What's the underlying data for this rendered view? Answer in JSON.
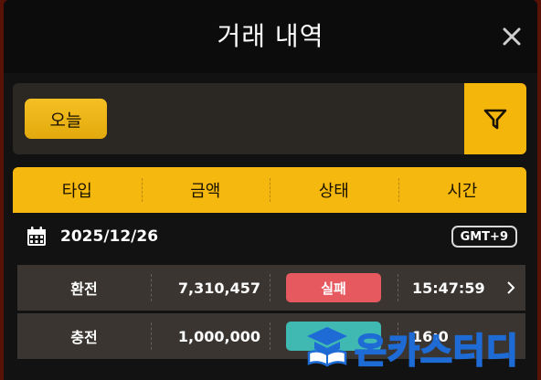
{
  "window": {
    "title": "거래 내역",
    "close_icon": "close-icon"
  },
  "filter": {
    "today_label": "오늘",
    "filter_icon": "funnel-icon"
  },
  "columns": [
    "타입",
    "금액",
    "상태",
    "시간"
  ],
  "date_group": {
    "icon": "calendar-icon",
    "date": "2025/12/26",
    "timezone": "GMT+9"
  },
  "rows": [
    {
      "type": "환전",
      "amount": "7,310,457",
      "status": "실패",
      "status_color": "#e65a5f",
      "time": "15:47:59",
      "arrow_icon": "chevron-right-icon"
    },
    {
      "type": "충전",
      "amount": "1,000,000",
      "status": "",
      "status_color": "#3fb9b2",
      "time": "16:0",
      "arrow_icon": ""
    }
  ],
  "watermark": {
    "text": "온카스터디",
    "logo_icon": "graduation-cap-book-icon",
    "color": "#1e6bd6"
  },
  "colors": {
    "accent": "#f5b80e",
    "header_bg": "#0c0c0c",
    "panel_bg": "#2b2823",
    "row_bg": "#3a3530",
    "failed": "#e65a5f",
    "success": "#3fb9b2"
  }
}
